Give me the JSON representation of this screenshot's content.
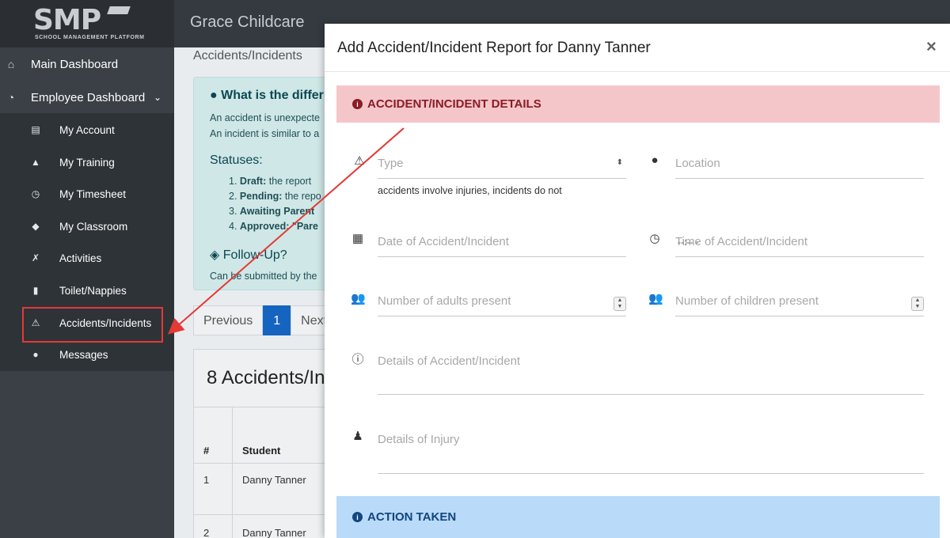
{
  "logo": {
    "big": "SMP",
    "small": "SCHOOL MANAGEMENT PLATFORM"
  },
  "header": {
    "school_name": "Grace Childcare"
  },
  "sidebar": {
    "main_dashboard": "Main Dashboard",
    "employee_dashboard": "Employee Dashboard",
    "items": [
      {
        "label": "My Account",
        "icon": "id-card-icon"
      },
      {
        "label": "My Training",
        "icon": "training-icon"
      },
      {
        "label": "My Timesheet",
        "icon": "clock-icon"
      },
      {
        "label": "My Classroom",
        "icon": "graduation-cap-icon"
      },
      {
        "label": "Activities",
        "icon": "running-icon"
      },
      {
        "label": "Toilet/Nappies",
        "icon": "toilet-icon"
      },
      {
        "label": "Accidents/Incidents",
        "icon": "warning-icon"
      },
      {
        "label": "Messages",
        "icon": "comment-icon"
      }
    ]
  },
  "main": {
    "breadcrumb": "Accidents/Incidents",
    "info": {
      "heading": "What is the differ",
      "line1": "An accident is unexpecte",
      "line2": "An incident is similar to a",
      "statuses": "Statuses:",
      "status_items": [
        {
          "num": "1.",
          "bold": "Draft:",
          "rest": " the report"
        },
        {
          "num": "2.",
          "bold": "Pending:",
          "rest": " the repo"
        },
        {
          "num": "3.",
          "bold": "Awaiting Parent ",
          "rest": ""
        },
        {
          "num": "4.",
          "bold": "Approved: \"Pare",
          "rest": ""
        }
      ],
      "followup": "Follow-Up?",
      "followup_text": "Can be submitted by the"
    },
    "pager": {
      "previous": "Previous",
      "page": "1",
      "next": "Next"
    },
    "card": {
      "title": "8 Accidents/In",
      "col_num": "#",
      "col_student": "Student",
      "rows": [
        {
          "num": "1",
          "student": "Danny Tanner"
        },
        {
          "num": "2",
          "student": "Danny Tanner"
        }
      ]
    }
  },
  "modal": {
    "title": "Add Accident/Incident Report for Danny Tanner",
    "close": "×",
    "section1": "ACCIDENT/INCIDENT DETAILS",
    "section2": "ACTION TAKEN",
    "fields": {
      "type": "Type",
      "type_hint": "accidents involve injuries, incidents do not",
      "location": "Location",
      "date": "Date of Accident/Incident",
      "time": "Time of Accident/Incident",
      "time_ghost": "--:-- -",
      "adults": "Number of adults present",
      "children": "Number of children present",
      "details": "Details of Accident/Incident",
      "injury": "Details of Injury"
    }
  },
  "colors": {
    "highlight": "#e53935",
    "section_red": "#f4c6ca",
    "section_blue": "#b9daf8",
    "active_page": "#1565c0"
  }
}
